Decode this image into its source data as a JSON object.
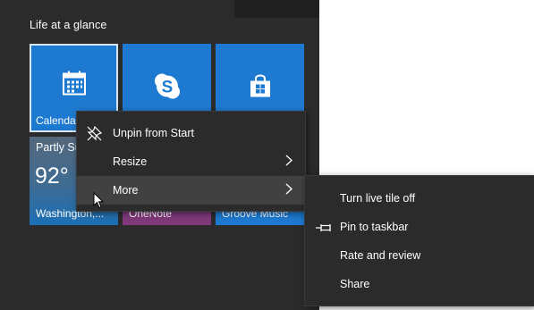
{
  "start": {
    "group_title": "Life at a glance",
    "tiles": {
      "calendar": {
        "label": "Calendar",
        "icon": "calendar-icon"
      },
      "skype": {
        "label": "",
        "icon": "skype-icon"
      },
      "store": {
        "label": "",
        "icon": "store-icon"
      },
      "weather": {
        "condition": "Partly Sunny",
        "temperature": "92°",
        "label": "Washington,..."
      },
      "onenote": {
        "label": "OneNote"
      },
      "groove": {
        "label": "Groove Music"
      }
    }
  },
  "context_menu": {
    "items": [
      {
        "label": "Unpin from Start",
        "icon": "unpin-icon"
      },
      {
        "label": "Resize",
        "submenu": true
      },
      {
        "label": "More",
        "submenu": true,
        "highlighted": true
      }
    ]
  },
  "submenu": {
    "items": [
      {
        "label": "Turn live tile off"
      },
      {
        "label": "Pin to taskbar",
        "icon": "pin-icon"
      },
      {
        "label": "Rate and review"
      },
      {
        "label": "Share"
      }
    ]
  },
  "colors": {
    "start_bg": "#2b2b2b",
    "tile_blue": "#1e7ad0",
    "onenote_purple": "#80397b",
    "menu_bg": "#2b2b2b",
    "menu_hover": "#414141"
  }
}
